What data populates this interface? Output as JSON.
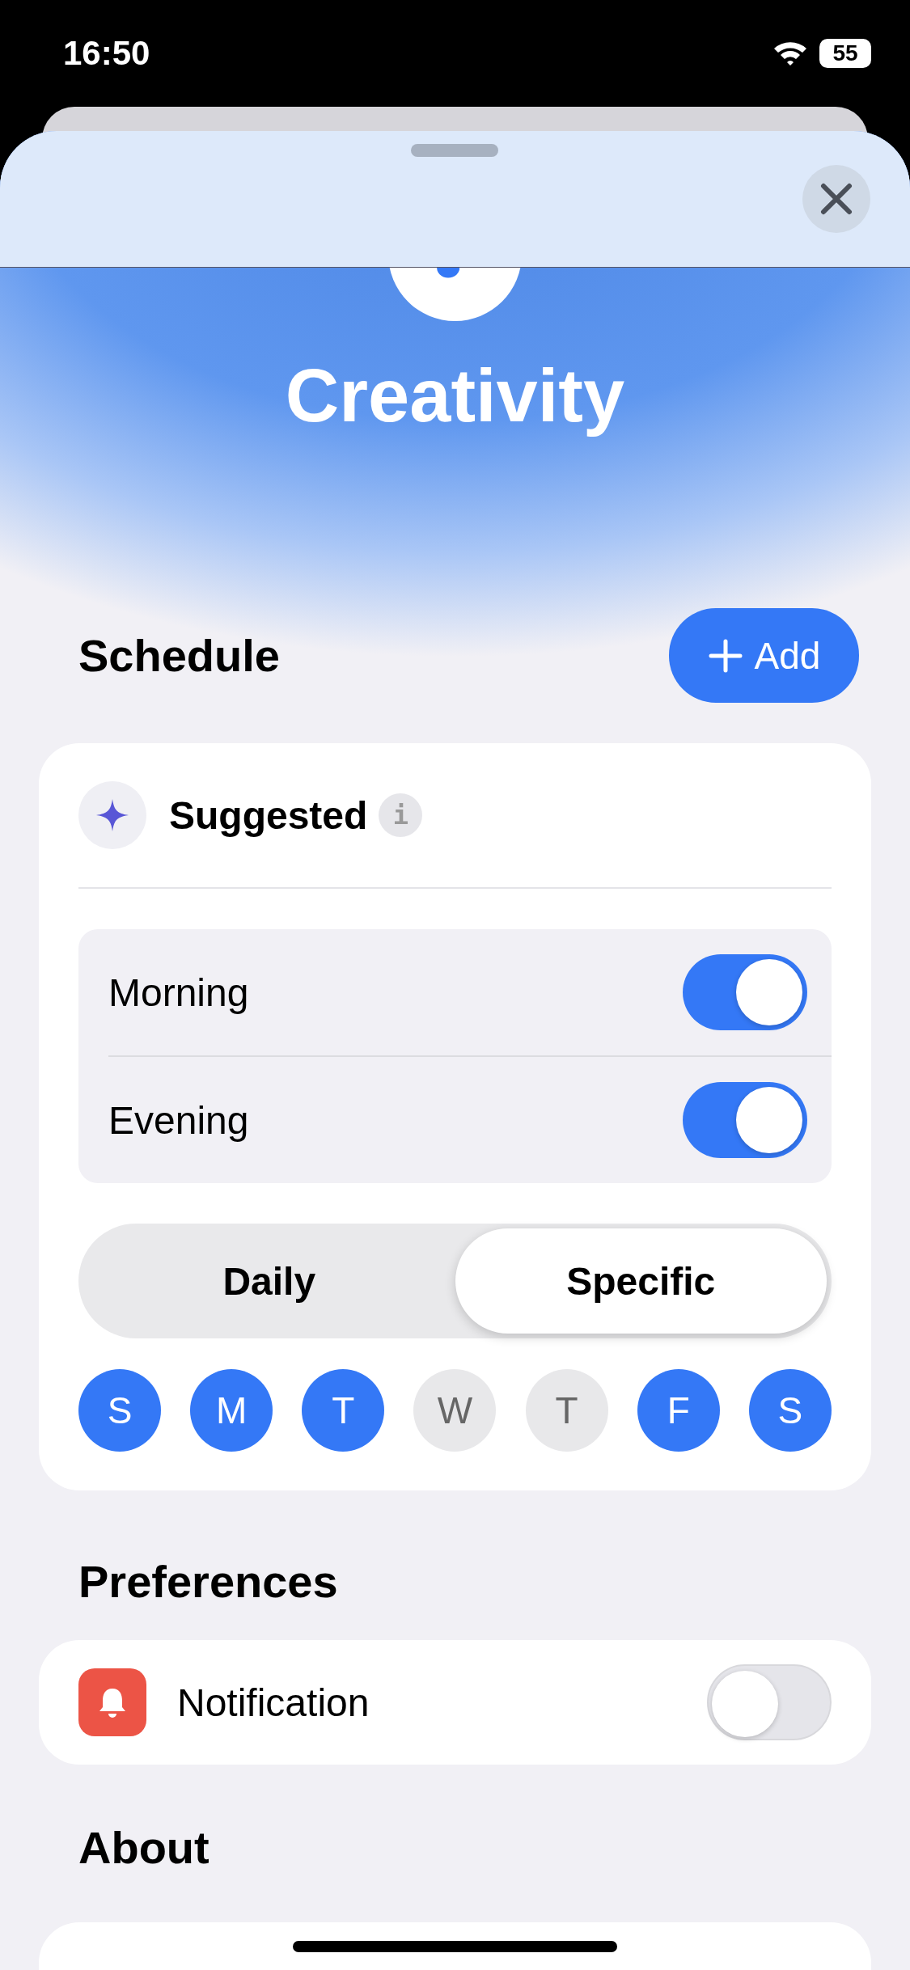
{
  "status_bar": {
    "time": "16:50",
    "battery": "55"
  },
  "header": {
    "title": "Creativity"
  },
  "schedule": {
    "title": "Schedule",
    "add_button": "Add",
    "suggested": {
      "label": "Suggested",
      "info": "i"
    },
    "times": [
      {
        "label": "Morning",
        "on": true
      },
      {
        "label": "Evening",
        "on": true
      }
    ],
    "frequency": [
      {
        "label": "Daily",
        "selected": false
      },
      {
        "label": "Specific",
        "selected": true
      }
    ],
    "days": [
      {
        "label": "S",
        "selected": true
      },
      {
        "label": "M",
        "selected": true
      },
      {
        "label": "T",
        "selected": true
      },
      {
        "label": "W",
        "selected": false
      },
      {
        "label": "T",
        "selected": false
      },
      {
        "label": "F",
        "selected": true
      },
      {
        "label": "S",
        "selected": true
      }
    ]
  },
  "preferences": {
    "title": "Preferences",
    "items": [
      {
        "label": "Notification",
        "on": false
      }
    ]
  },
  "about": {
    "title": "About"
  }
}
